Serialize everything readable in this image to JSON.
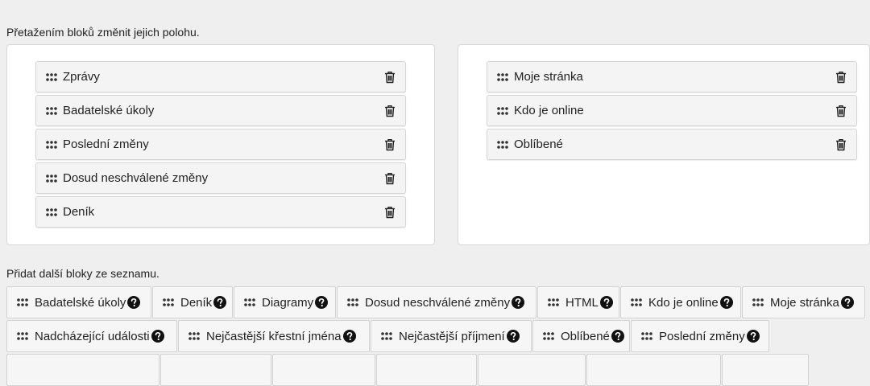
{
  "instructions": {
    "drag_hint": "Přetažením bloků změnit jejich polohu.",
    "add_hint": "Přidat další bloky ze seznamu."
  },
  "left_column": {
    "blocks": [
      {
        "label": "Zprávy"
      },
      {
        "label": "Badatelské úkoly"
      },
      {
        "label": "Poslední změny"
      },
      {
        "label": "Dosud neschválené změny"
      },
      {
        "label": "Deník"
      }
    ]
  },
  "right_column": {
    "blocks": [
      {
        "label": "Moje stránka"
      },
      {
        "label": "Kdo je online"
      },
      {
        "label": "Oblíbené"
      }
    ]
  },
  "available_blocks": [
    {
      "label": "Badatelské úkoly"
    },
    {
      "label": "Deník"
    },
    {
      "label": "Diagramy"
    },
    {
      "label": "Dosud neschválené změny"
    },
    {
      "label": "HTML"
    },
    {
      "label": "Kdo je online"
    },
    {
      "label": "Moje stránka"
    },
    {
      "label": "Nadcházející události"
    },
    {
      "label": "Nejčastější křestní jména"
    },
    {
      "label": "Nejčastější příjmení"
    },
    {
      "label": "Oblíbené"
    },
    {
      "label": "Poslední změny"
    }
  ],
  "icons": {
    "block_handle": "grip-icon",
    "delete": "trash-icon",
    "help": "question-circle-icon"
  },
  "colors": {
    "background": "#efefef",
    "panel": "#ffffff",
    "block": "#f4f4f4",
    "text": "#222222"
  }
}
